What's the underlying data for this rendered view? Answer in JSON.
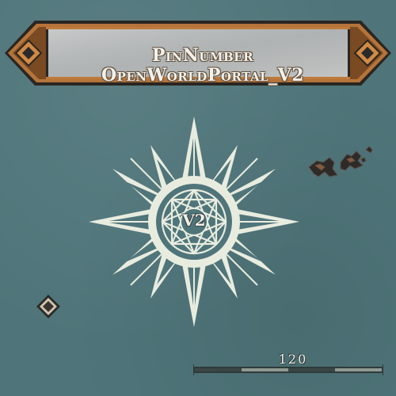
{
  "banner": {
    "line1": "PinNumber",
    "line2": "OpenWorldPortal_V2"
  },
  "portal": {
    "label": "V2",
    "icon": "compass-star-icon"
  },
  "map_marker": {
    "icon": "diamond-marker-icon"
  },
  "creatures": {
    "icon": "creature-group-icon"
  },
  "scale": {
    "label": "120"
  },
  "colors": {
    "water": "#4f757a",
    "banner_wood": "#b5743a",
    "banner_stone": "#bcbfbf",
    "compass_ink": "#e8ecdf"
  }
}
